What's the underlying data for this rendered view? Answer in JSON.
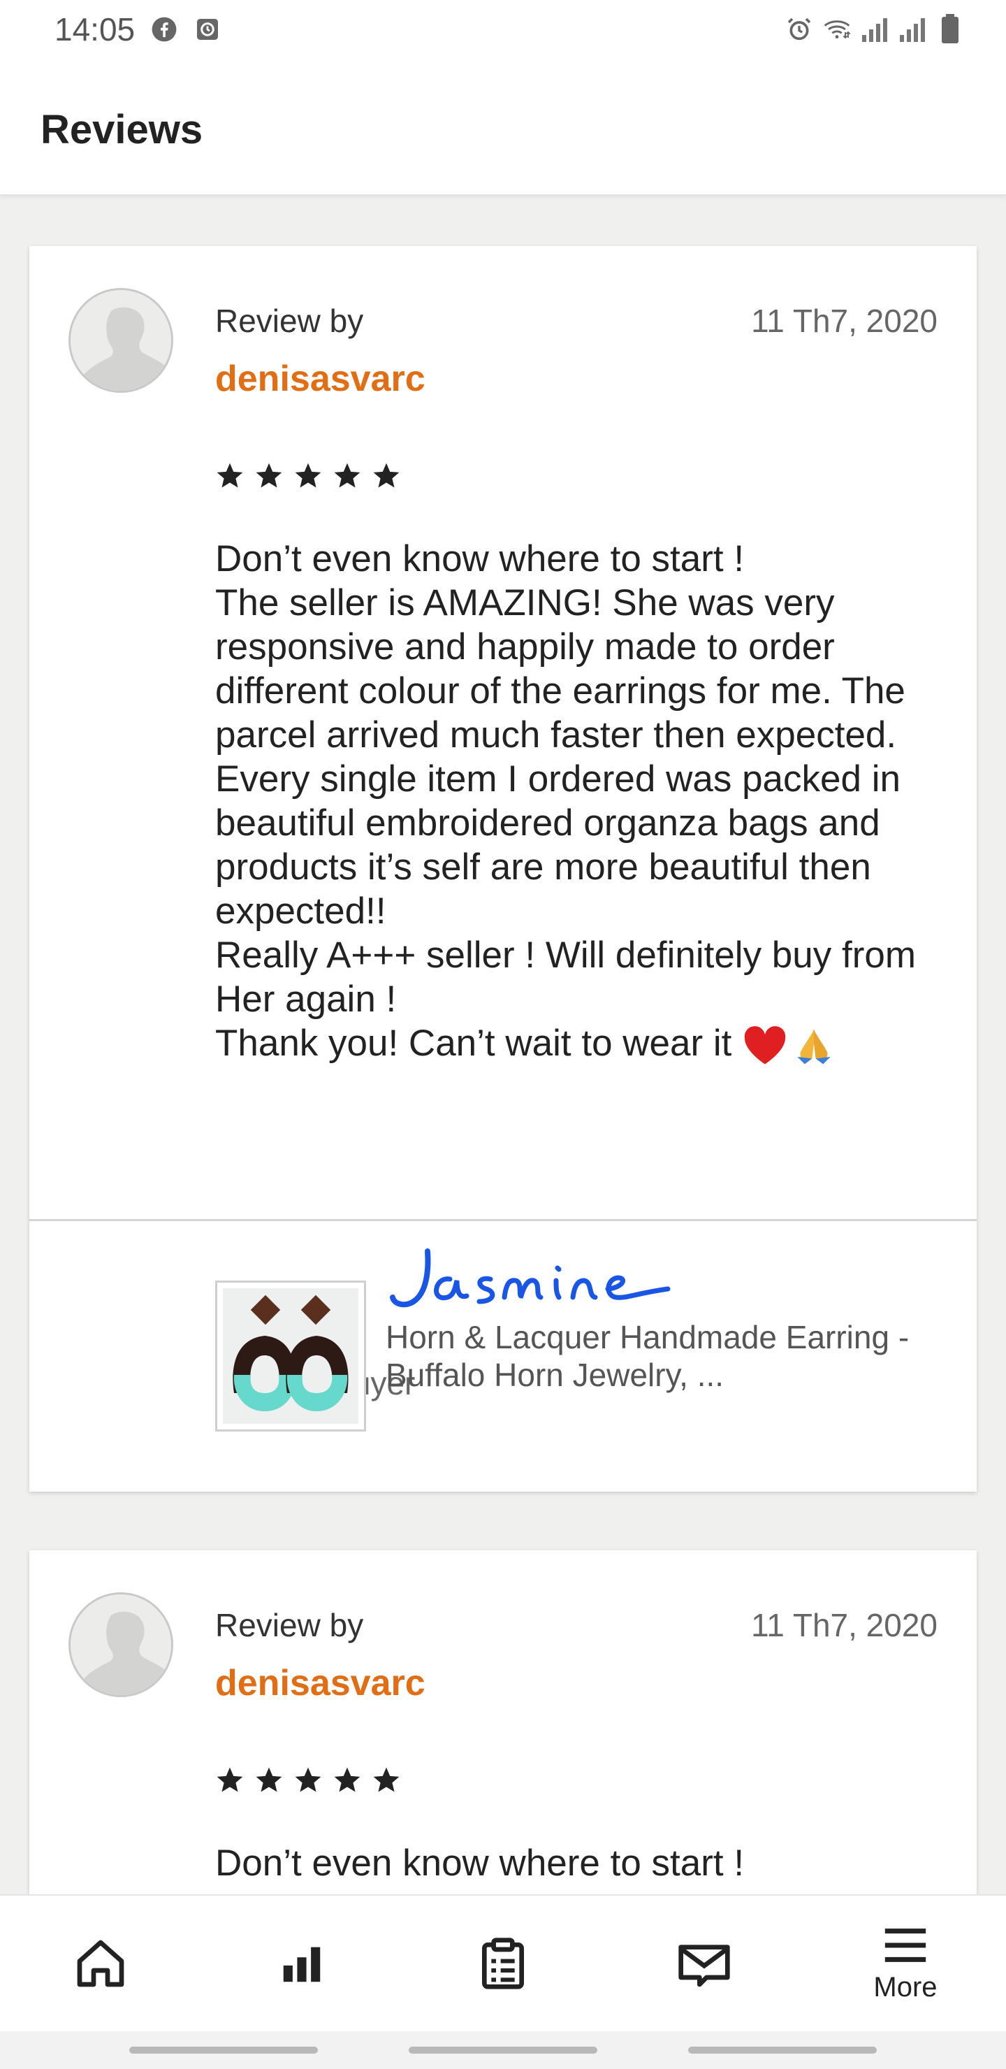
{
  "status_bar": {
    "time": "14:05",
    "left_icons": [
      "facebook-icon",
      "clock-app-icon"
    ],
    "right_icons": [
      "alarm-icon",
      "wifi-icon",
      "signal-1-icon",
      "signal-2-icon",
      "battery-icon"
    ]
  },
  "header": {
    "title": "Reviews"
  },
  "reviews": [
    {
      "review_by_label": "Review by",
      "reviewer": "denisasvarc",
      "date": "11 Th7, 2020",
      "rating": 5,
      "text": "Don’t even know where to start !\nThe seller is AMAZING! She was very responsive and happily made to order different colour of the earrings for me. The parcel arrived much faster then expected. Every single item I ordered was packed in beautiful embroidered organza bags and products it’s self are more beautiful then expected!!\nReally A+++ seller ! Will definitely buy from Her again !\nThank you! Can’t wait to wear it",
      "emojis": [
        "❤️",
        "🙏"
      ],
      "signature": "Jasmine",
      "contact_label": "Contact buyer",
      "listing_title": "Horn & Lacquer Handmade Earring - Buffalo Horn Jewelry, ..."
    },
    {
      "review_by_label": "Review by",
      "reviewer": "denisasvarc",
      "date": "11 Th7, 2020",
      "rating": 5,
      "text": "Don’t even know where to start !"
    }
  ],
  "bottom_nav": {
    "items": [
      {
        "icon": "home-icon"
      },
      {
        "icon": "stats-icon"
      },
      {
        "icon": "orders-icon"
      },
      {
        "icon": "messages-icon"
      },
      {
        "icon": "menu-icon",
        "label": "More"
      }
    ]
  },
  "colors": {
    "reviewer_name": "#e16e15",
    "signature": "#1a56e6",
    "heart": "#e02020",
    "teal": "#66d8cc"
  }
}
